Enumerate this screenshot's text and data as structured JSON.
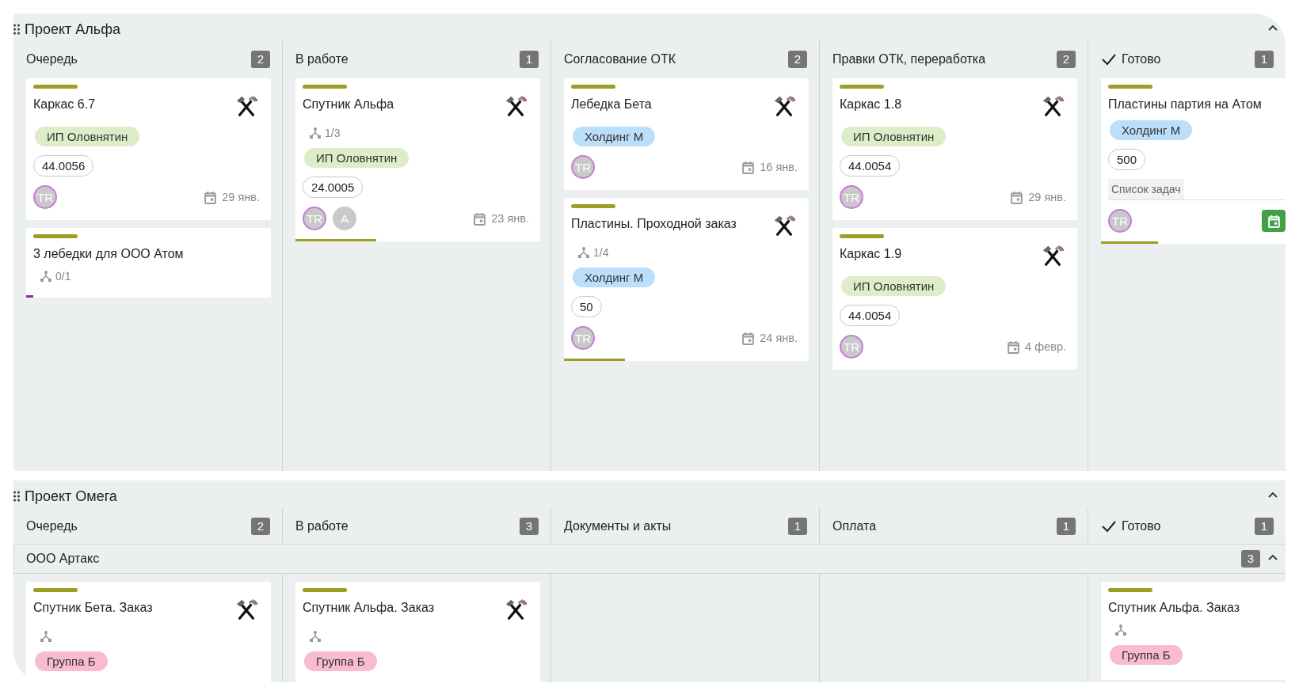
{
  "boards": [
    {
      "title": "Проект Альфа",
      "expanded": true,
      "columns": [
        {
          "title": "Очередь",
          "count": "2",
          "done": false
        },
        {
          "title": "В работе",
          "count": "1",
          "done": false
        },
        {
          "title": "Согласование ОТК",
          "count": "2",
          "done": false
        },
        {
          "title": "Правки ОТК, переработка",
          "count": "2",
          "done": false
        },
        {
          "title": "Готово",
          "count": "1",
          "done": true
        }
      ],
      "lanes": [
        {
          "cells": [
            [
              {
                "title": "Каркас 6.7",
                "tool": true,
                "tags": [
                  {
                    "label": "ИП Оловнятин",
                    "color": "#dcedc8"
                  }
                ],
                "number": "44.0056",
                "avatars": [
                  {
                    "initials": "TR",
                    "highlighted": true
                  }
                ],
                "due_date": "29 янв."
              },
              {
                "title": "3 лебедки для ООО Атом",
                "tool": false,
                "subtasks": true,
                "subtask_count": "0/1",
                "progress": {
                  "level": 0.03,
                  "color": "#9c27b0"
                }
              }
            ],
            [
              {
                "title": "Спутник Альфа",
                "tool": true,
                "subtasks": true,
                "subtask_count": "1/3",
                "tags": [
                  {
                    "label": "ИП Оловнятин",
                    "color": "#dcedc8"
                  }
                ],
                "number": "24.0005",
                "avatars": [
                  {
                    "initials": "TR",
                    "highlighted": true
                  },
                  {
                    "initials": "A",
                    "highlighted": false
                  }
                ],
                "due_date": "23 янв.",
                "progress": {
                  "level": 0.33,
                  "color": "#9e9d24"
                }
              }
            ],
            [
              {
                "title": "Лебедка Бета",
                "tool": true,
                "tags": [
                  {
                    "label": "Холдинг М",
                    "color": "#bbdefb"
                  }
                ],
                "avatars": [
                  {
                    "initials": "TR",
                    "highlighted": true
                  }
                ],
                "due_date": "16 янв."
              },
              {
                "title": "Пластины. Проходной заказ",
                "tool": true,
                "subtasks": true,
                "subtask_count": "1/4",
                "tags": [
                  {
                    "label": "Холдинг М",
                    "color": "#bbdefb"
                  }
                ],
                "number": "50",
                "avatars": [
                  {
                    "initials": "TR",
                    "highlighted": true
                  }
                ],
                "due_date": "24 янв.",
                "progress": {
                  "level": 0.25,
                  "color": "#9e9d24"
                }
              }
            ],
            [
              {
                "title": "Каркас 1.8",
                "tool": true,
                "tags": [
                  {
                    "label": "ИП Оловнятин",
                    "color": "#dcedc8"
                  }
                ],
                "number": "44.0054",
                "avatars": [
                  {
                    "initials": "TR",
                    "highlighted": true
                  }
                ],
                "due_date": "29 янв."
              },
              {
                "title": "Каркас 1.9",
                "tool": true,
                "tags": [
                  {
                    "label": "ИП Оловнятин",
                    "color": "#dcedc8"
                  }
                ],
                "number": "44.0054",
                "avatars": [
                  {
                    "initials": "TR",
                    "highlighted": true
                  }
                ],
                "due_date": "4 февр."
              }
            ],
            [
              {
                "title": "Пластины партия на Атом",
                "tool": false,
                "tags": [
                  {
                    "label": "Холдинг М",
                    "color": "#bbdefb"
                  }
                ],
                "number": "500",
                "field_placeholder": "Список задач",
                "avatars": [
                  {
                    "initials": "TR",
                    "highlighted": true
                  }
                ],
                "calendar_button": true,
                "progress": {
                  "level": 0.31,
                  "color": "#9e9d24"
                }
              }
            ]
          ]
        }
      ]
    },
    {
      "title": "Проект Омега",
      "expanded": true,
      "columns": [
        {
          "title": "Очередь",
          "count": "2",
          "done": false
        },
        {
          "title": "В работе",
          "count": "3",
          "done": false
        },
        {
          "title": "Документы и акты",
          "count": "1",
          "done": false
        },
        {
          "title": "Оплата",
          "count": "1",
          "done": false
        },
        {
          "title": "Готово",
          "count": "1",
          "done": true
        }
      ],
      "lanes": [
        {
          "title": "ООО Артакс",
          "count": "3",
          "expanded": true,
          "cells": [
            [
              {
                "title": "Спутник Бета. Заказ",
                "tool": true,
                "subtasks": true,
                "tags": [
                  {
                    "label": "Группа Б",
                    "color": "#f8bbd0"
                  }
                ]
              }
            ],
            [
              {
                "title": "Спутник Альфа. Заказ",
                "tool": true,
                "subtasks": true,
                "tags": [
                  {
                    "label": "Группа Б",
                    "color": "#f8bbd0"
                  }
                ]
              }
            ],
            [],
            [],
            [
              {
                "title": "Спутник Альфа. Заказ",
                "tool": false,
                "subtasks": true,
                "tags": [
                  {
                    "label": "Группа Б",
                    "color": "#f8bbd0"
                  }
                ]
              }
            ]
          ]
        }
      ]
    }
  ]
}
